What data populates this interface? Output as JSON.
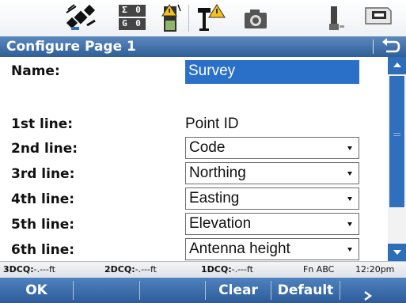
{
  "status_icons": [
    "satellite-icon",
    "sigma-counter-icon",
    "battery-warning-icon",
    "antenna-warning-icon",
    "camera-icon",
    "usb-device-icon",
    "memory-card-icon"
  ],
  "status_sigma": {
    "row1": "Σ 0",
    "row2": "G 0"
  },
  "title": "Configure Page 1",
  "form": {
    "name_label": "Name:",
    "name_value": "Survey",
    "line1_label": "1st line:",
    "line1_value": "Point ID",
    "line2_label": "2nd line:",
    "line2_value": "Code",
    "line3_label": "3rd line:",
    "line3_value": "Northing",
    "line4_label": "4th line:",
    "line4_value": "Easting",
    "line5_label": "5th line:",
    "line5_value": "Elevation",
    "line6_label": "6th line:",
    "line6_value": "Antenna height"
  },
  "info": {
    "q3_label": "3DCQ:",
    "q3_value": "-.---ft",
    "q2_label": "2DCQ:",
    "q2_value": "-.---ft",
    "q1_label": "1DCQ:",
    "q1_value": "-.---ft",
    "mode": "Fn ABC",
    "time": "12:20pm"
  },
  "softkeys": {
    "ok": "OK",
    "clear": "Clear",
    "default": "Default"
  },
  "colors": {
    "accent": "#2f5f99",
    "field_highlight": "#2a70c9",
    "warning": "#f4c21a"
  }
}
